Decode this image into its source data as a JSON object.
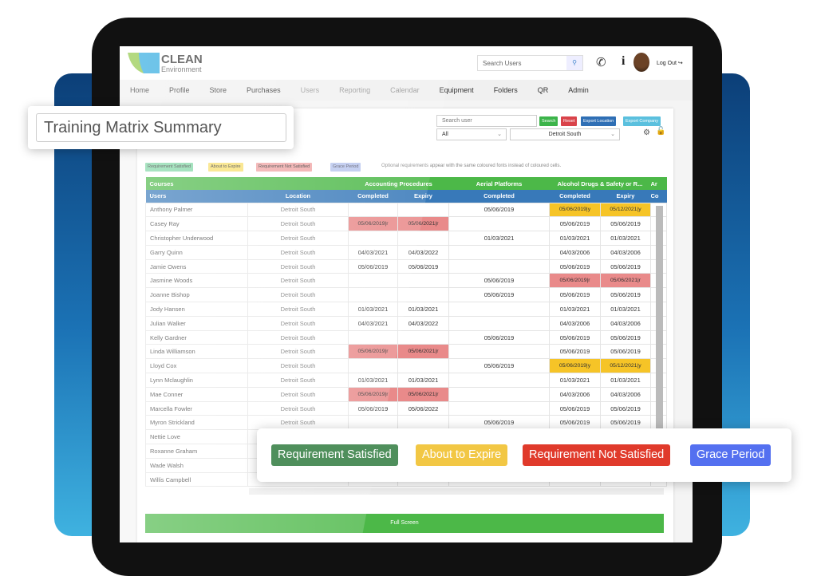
{
  "header": {
    "logo_line1": "CLEAN",
    "logo_line2": "Environment",
    "search_placeholder": "Search Users",
    "logout": "Log Out"
  },
  "nav": [
    "Home",
    "Profile",
    "Store",
    "Purchases",
    "Users",
    "Reporting",
    "Calendar",
    "Equipment",
    "Folders",
    "QR",
    "Admin"
  ],
  "overlay_title": "Training Matrix Summary",
  "controls": {
    "search_placeholder": "Search user",
    "search": "Search",
    "reset": "Reset",
    "export_location": "Export Location",
    "export_company": "Export Company",
    "filter1": "All",
    "filter2": "Detroit South"
  },
  "legend": {
    "satisfied": "Requirement Satisfied",
    "expire": "About to Expire",
    "not_satisfied": "Requirement Not Satisfied",
    "grace": "Grace Period",
    "note": "Optional requirements appear with the same coloured fonts instead of coloured cells."
  },
  "colors": {
    "satisfied": "#4f8f5c",
    "expire": "#f2c744",
    "not_satisfied": "#e03a2b",
    "grace": "#5470f0",
    "header_green": "#4cb848",
    "header_blue": "#3879b9"
  },
  "table": {
    "courses_label": "Courses",
    "users_label": "Users",
    "location_label": "Location",
    "courses": [
      "Accounting Procedures",
      "Aerial Platforms",
      "Alcohol Drugs & Safety or R...",
      "Ar"
    ],
    "subheaders": [
      "Completed",
      "Expiry",
      "Completed",
      "Completed",
      "Expiry",
      "Co"
    ],
    "rows": [
      [
        "Anthony Palmer",
        "Detroit South",
        "",
        "",
        "05/06/2019",
        "05/06/2019|y",
        "05/12/2021|y"
      ],
      [
        "Casey Ray",
        "Detroit South",
        "05/06/2019|r",
        "05/06/2021|r",
        "",
        "05/06/2019",
        "05/06/2019"
      ],
      [
        "Christopher Underwood",
        "Detroit South",
        "",
        "",
        "01/03/2021",
        "01/03/2021",
        "01/03/2021"
      ],
      [
        "Garry Quinn",
        "Detroit South",
        "04/03/2021",
        "04/03/2022",
        "",
        "04/03/2006",
        "04/03/2006"
      ],
      [
        "Jamie Owens",
        "Detroit South",
        "05/06/2019",
        "05/06/2019",
        "",
        "05/06/2019",
        "05/06/2019"
      ],
      [
        "Jasmine Woods",
        "Detroit South",
        "",
        "",
        "05/06/2019",
        "05/06/2019|r",
        "05/06/2021|r"
      ],
      [
        "Joanne Bishop",
        "Detroit South",
        "",
        "",
        "05/06/2019",
        "05/06/2019",
        "05/06/2019"
      ],
      [
        "Jody Hansen",
        "Detroit South",
        "01/03/2021",
        "01/03/2021",
        "",
        "01/03/2021",
        "01/03/2021"
      ],
      [
        "Julian Walker",
        "Detroit South",
        "04/03/2021",
        "04/03/2022",
        "",
        "04/03/2006",
        "04/03/2006"
      ],
      [
        "Kelly Gardner",
        "Detroit South",
        "",
        "",
        "05/06/2019",
        "05/06/2019",
        "05/06/2019"
      ],
      [
        "Linda Williamson",
        "Detroit South",
        "05/06/2019|r",
        "05/06/2021|r",
        "",
        "05/06/2019",
        "05/06/2019"
      ],
      [
        "Lloyd Cox",
        "Detroit South",
        "",
        "",
        "05/06/2019",
        "05/06/2019|y",
        "05/12/2021|y"
      ],
      [
        "Lynn Mclaughlin",
        "Detroit South",
        "01/03/2021",
        "01/03/2021",
        "",
        "01/03/2021",
        "01/03/2021"
      ],
      [
        "Mae Conner",
        "Detroit South",
        "05/06/2019|r",
        "05/06/2021|r",
        "",
        "04/03/2006",
        "04/03/2006"
      ],
      [
        "Marcella Fowler",
        "Detroit South",
        "05/06/2019",
        "05/06/2022",
        "",
        "05/06/2019",
        "05/06/2019"
      ],
      [
        "Myron Strickland",
        "Detroit South",
        "",
        "",
        "05/06/2019",
        "05/06/2019",
        "05/06/2019"
      ],
      [
        "Nettie Love",
        "",
        "",
        "",
        "",
        "",
        ""
      ],
      [
        "Roxanne Graham",
        "",
        "",
        "",
        "",
        "",
        ""
      ],
      [
        "Wade Walsh",
        "",
        "",
        "",
        "",
        "",
        ""
      ],
      [
        "Willis Campbell",
        "",
        "",
        "",
        "",
        "",
        ""
      ]
    ]
  },
  "full_screen": "Full Screen"
}
